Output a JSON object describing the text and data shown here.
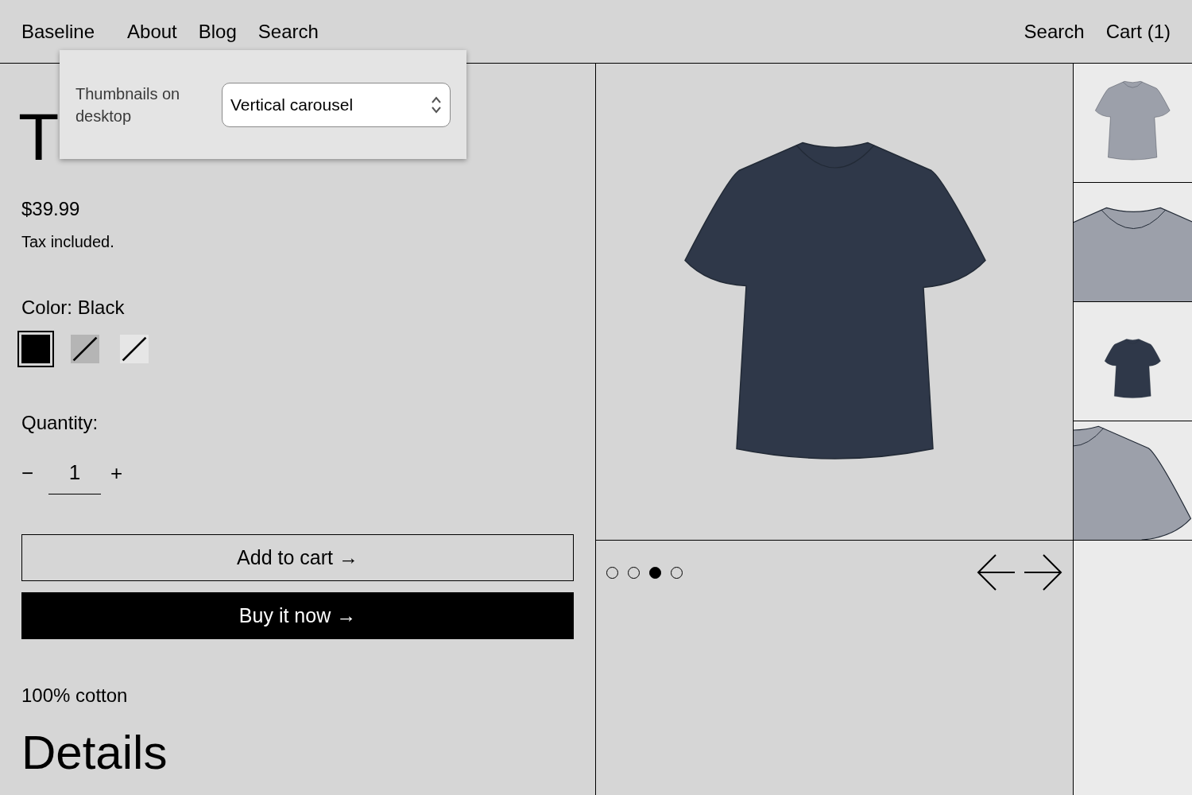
{
  "header": {
    "logo": "Baseline",
    "nav": [
      {
        "label": "About"
      },
      {
        "label": "Blog"
      },
      {
        "label": "Search"
      }
    ],
    "actions": [
      {
        "label": "Search"
      },
      {
        "label": "Cart (1)"
      }
    ]
  },
  "settings_popover": {
    "label": "Thumbnails on desktop",
    "select": {
      "value": "Vertical carousel"
    }
  },
  "product": {
    "title": "T",
    "price": "$39.99",
    "tax_note": "Tax included.",
    "color_label": "Color: Black",
    "swatches": [
      {
        "color": "#000000",
        "selected": true,
        "available": true
      },
      {
        "color": "#b5b5b5",
        "selected": false,
        "available": false
      },
      {
        "color": "#e6e6e6",
        "selected": false,
        "available": false
      }
    ],
    "quantity_label": "Quantity:",
    "quantity": {
      "decrease": "−",
      "value": "1",
      "increase": "+"
    },
    "add_to_cart": "Add to cart →",
    "buy_now": "Buy it now →",
    "material": "100% cotton",
    "details_heading": "Details"
  },
  "gallery": {
    "main_image": {
      "color": "#2f3849"
    },
    "dots": [
      {
        "selected": false
      },
      {
        "selected": false
      },
      {
        "selected": true
      },
      {
        "selected": false
      }
    ],
    "thumbnails": [
      {
        "kind": "full",
        "color": "#9ca0aa"
      },
      {
        "kind": "neck",
        "color": "#9ca0aa"
      },
      {
        "kind": "small",
        "color": "#2f3849"
      },
      {
        "kind": "shoulder",
        "color": "#9ca0aa"
      }
    ]
  }
}
